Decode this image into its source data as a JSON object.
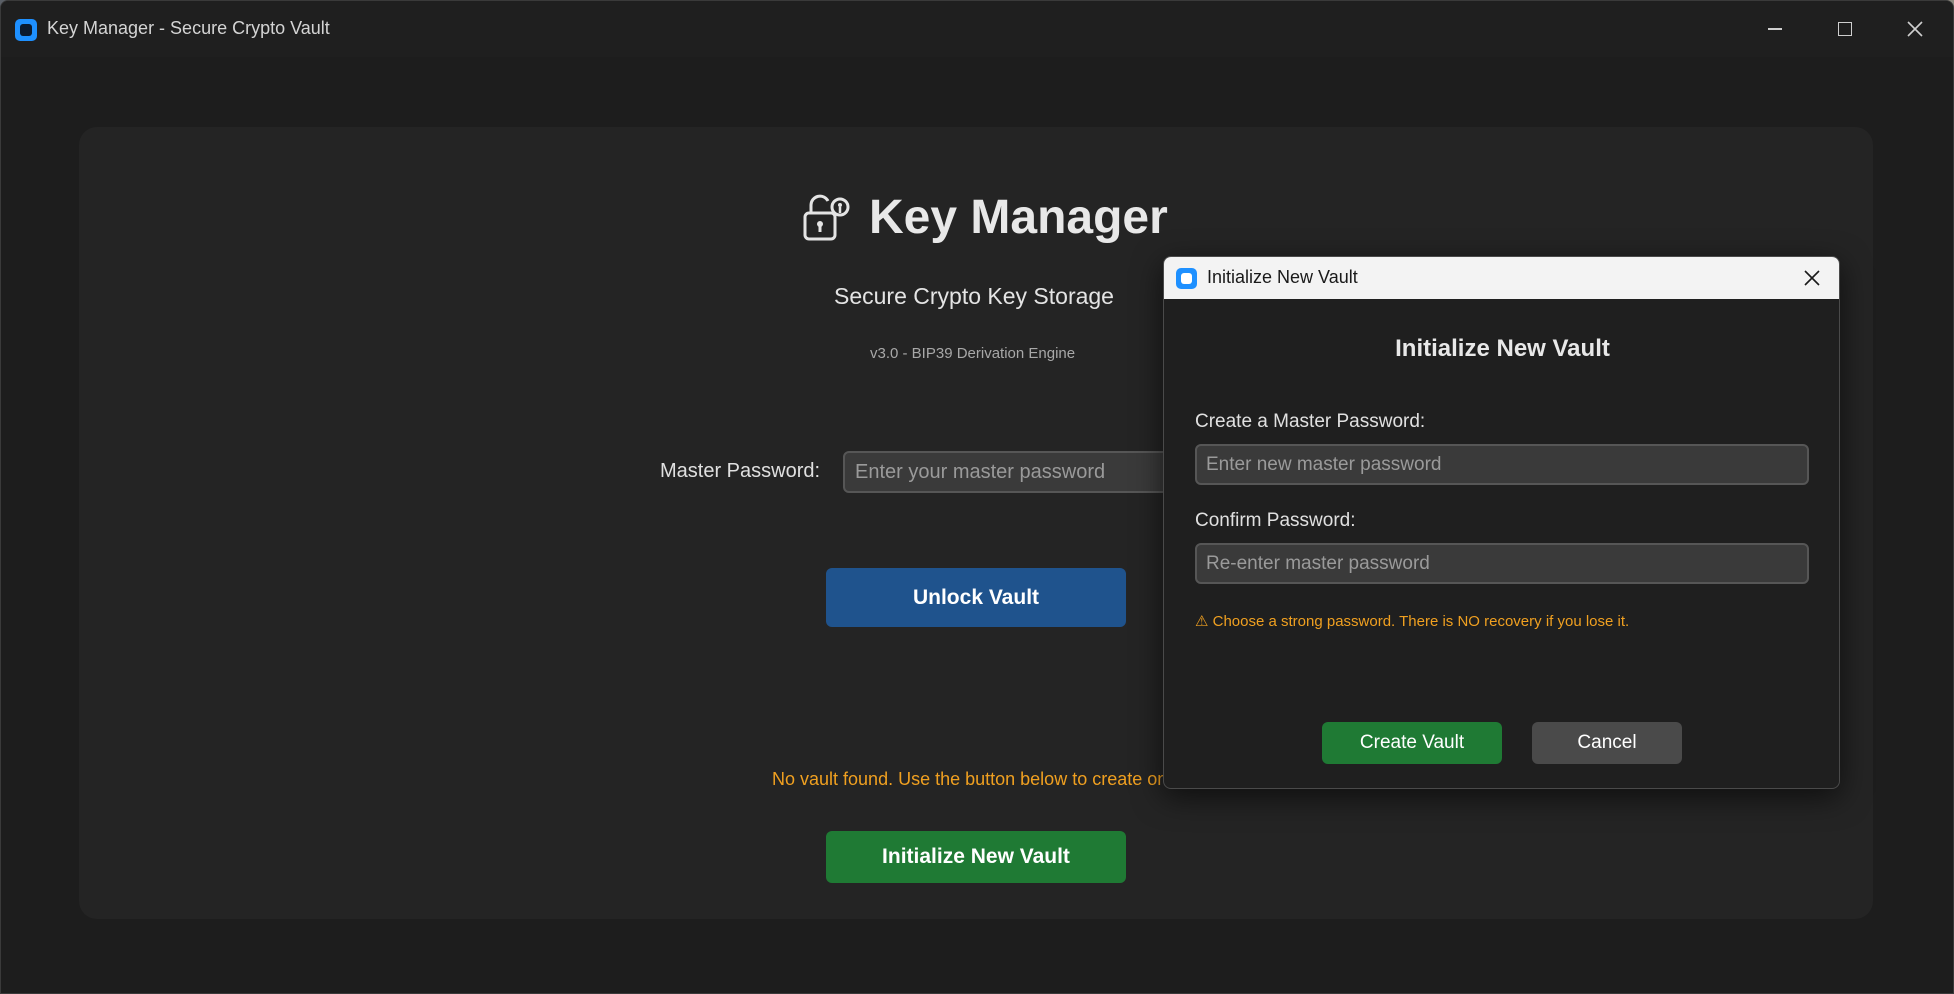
{
  "window": {
    "title": "Key Manager - Secure Crypto Vault",
    "controls": [
      "minimize",
      "maximize",
      "close"
    ]
  },
  "main": {
    "app_name": "Key Manager",
    "subtitle": "Secure Crypto Key Storage",
    "version": "v3.0 - BIP39 Derivation Engine",
    "master_password_label": "Master Password:",
    "master_password_placeholder": "Enter your master password",
    "unlock_button": "Unlock Vault",
    "no_vault_message": "No vault found. Use the button below to create on",
    "init_button": "Initialize New Vault"
  },
  "dialog": {
    "window_title": "Initialize New Vault",
    "heading": "Initialize New Vault",
    "create_label": "Create a Master Password:",
    "create_placeholder": "Enter new master password",
    "confirm_label": "Confirm Password:",
    "confirm_placeholder": "Re-enter master password",
    "warning": "⚠ Choose a strong password. There is NO recovery if you lose it.",
    "create_button": "Create Vault",
    "cancel_button": "Cancel"
  },
  "colors": {
    "accent_blue": "#1f538d",
    "accent_green": "#1f7a34",
    "warning_orange": "#f0a020",
    "panel_bg": "#242424",
    "window_bg": "#1d1d1d"
  },
  "icons": {
    "app": "app-icon",
    "brand": "lock-key-icon",
    "close": "close-icon"
  }
}
